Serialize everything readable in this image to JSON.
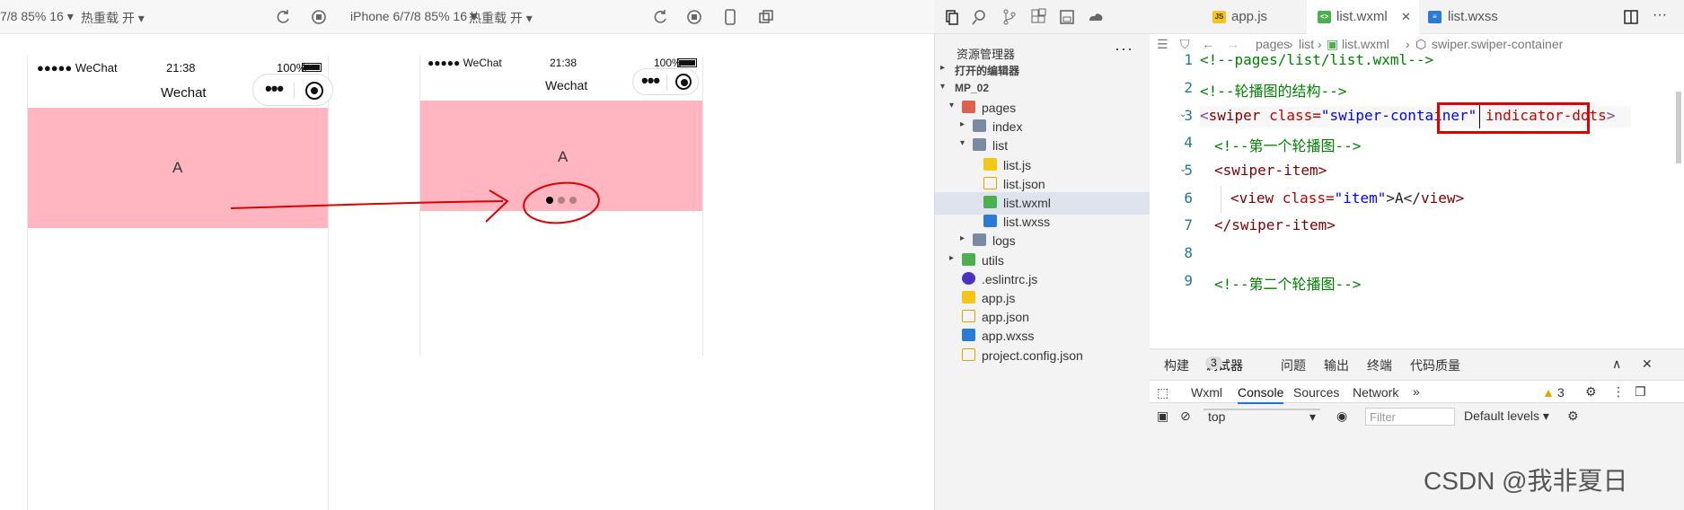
{
  "toolbar": {
    "left_device": "7/8 85% 16 ▾",
    "left_hotreload": "热重载 开 ▾",
    "right_device": "iPhone 6/7/8 85% 16 ▾",
    "right_hotreload": "热重载 开 ▾"
  },
  "phone_before": {
    "carrier": "●●●●● WeChat",
    "time": "21:38",
    "battery": "100%",
    "nav_title": "Wechat",
    "slide_text": "A"
  },
  "phone_after": {
    "carrier": "●●●●● WeChat",
    "time": "21:38",
    "battery": "100%",
    "nav_title": "Wechat",
    "slide_text": "A",
    "indicator_count": 3
  },
  "explorer": {
    "title": "资源管理器",
    "more": "···",
    "open_editors": "打开的编辑器",
    "project": "MP_02",
    "tree": [
      {
        "label": "pages",
        "type": "folder-red",
        "depth": 1,
        "chevron": "▾"
      },
      {
        "label": "index",
        "type": "folder",
        "depth": 2,
        "chevron": "▸"
      },
      {
        "label": "list",
        "type": "folder",
        "depth": 2,
        "chevron": "▾"
      },
      {
        "label": "list.js",
        "type": "js",
        "depth": 3,
        "chevron": ""
      },
      {
        "label": "list.json",
        "type": "json",
        "depth": 3,
        "chevron": ""
      },
      {
        "label": "list.wxml",
        "type": "wxml",
        "depth": 3,
        "chevron": "",
        "selected": true
      },
      {
        "label": "list.wxss",
        "type": "wxss",
        "depth": 3,
        "chevron": ""
      },
      {
        "label": "logs",
        "type": "folder",
        "depth": 2,
        "chevron": "▸"
      },
      {
        "label": "utils",
        "type": "folder-green",
        "depth": 1,
        "chevron": "▸"
      },
      {
        "label": ".eslintrc.js",
        "type": "eslint",
        "depth": 1,
        "chevron": ""
      },
      {
        "label": "app.js",
        "type": "js",
        "depth": 1,
        "chevron": ""
      },
      {
        "label": "app.json",
        "type": "json",
        "depth": 1,
        "chevron": ""
      },
      {
        "label": "app.wxss",
        "type": "wxss",
        "depth": 1,
        "chevron": ""
      },
      {
        "label": "project.config.json",
        "type": "json",
        "depth": 1,
        "chevron": ""
      }
    ]
  },
  "tabs": [
    {
      "label": "app.js",
      "icon": "js"
    },
    {
      "label": "list.wxml",
      "icon": "wxml",
      "active": true,
      "close": "✕"
    },
    {
      "label": "list.wxss",
      "icon": "wxss"
    }
  ],
  "breadcrumb": {
    "pages": "pages",
    "list": "list",
    "file": "list.wxml",
    "symbol": "swiper.swiper-container"
  },
  "code": {
    "line_numbers": [
      "1",
      "2",
      "3",
      "4",
      "5",
      "6",
      "7",
      "8",
      "9"
    ],
    "l1": "<!--pages/list/list.wxml-->",
    "l2": "<!--轮播图的结构-->",
    "l3_open": "<",
    "l3_tag": "swiper",
    "l3_attr": " class=",
    "l3_str": "\"swiper-container\"",
    "l3_attr2": " indicator-dots",
    "l3_close": ">",
    "l4": "<!--第一个轮播图-->",
    "l5": "<swiper-item>",
    "l6_open": "<view",
    "l6_attr": " class=",
    "l6_str": "\"item\"",
    "l6_text": ">A</",
    "l6_close": "view>",
    "l7": "</swiper-item>",
    "l9": "<!--第二个轮播图-->"
  },
  "debug": {
    "tabs": [
      "构建",
      "调试器",
      "问题",
      "输出",
      "终端",
      "代码质量"
    ],
    "badge": "3",
    "devtools_tabs": [
      "Wxml",
      "Console",
      "Sources",
      "Network"
    ],
    "more": "»",
    "warn_count": "3",
    "context": "top",
    "filter_placeholder": "Filter",
    "levels": "Default levels ▾"
  },
  "watermark": "CSDN @我非夏日",
  "colors": {
    "swiper_bg": "#ffb6c1",
    "annotation_red": "#e00000"
  }
}
